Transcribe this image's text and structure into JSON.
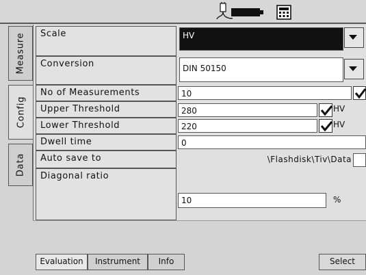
{
  "side_tabs": [
    "Measure",
    "Config",
    "Data"
  ],
  "rows": {
    "scale": {
      "label": "Scale",
      "value": "HV"
    },
    "conversion": {
      "label": "Conversion",
      "value": "DIN 50150"
    },
    "measurements": {
      "label": "No of Measurements",
      "value": "10"
    },
    "upper": {
      "label": "Upper Threshold",
      "value": "280",
      "unit": "HV"
    },
    "lower": {
      "label": "Lower Threshold",
      "value": "220",
      "unit": "HV"
    },
    "dwell": {
      "label": "Dwell time",
      "value": "0"
    },
    "autosave": {
      "label": "Auto save to",
      "value": "\\Flashdisk\\Tiv\\Data"
    },
    "diagonal": {
      "label": "Diagonal ratio",
      "value": "10",
      "unit": "%"
    }
  },
  "bottom_tabs": [
    "Evaluation",
    "Instrument",
    "Info"
  ],
  "select_label": "Select",
  "icons": [
    "power-plug-icon",
    "battery-icon",
    "calculator-icon",
    "chevron-down-icon",
    "checkmark-icon"
  ]
}
